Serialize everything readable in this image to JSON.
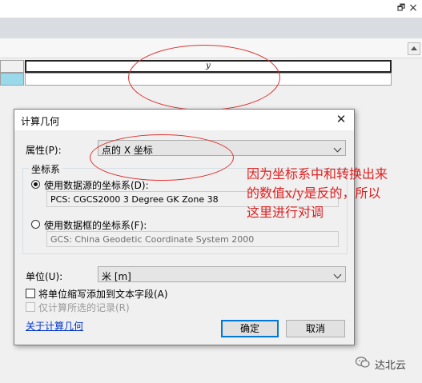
{
  "window": {
    "pin_glyph": "🗗",
    "close_glyph": "×"
  },
  "table": {
    "columns": [
      "y"
    ],
    "rows": [
      [
        ""
      ]
    ]
  },
  "dialog": {
    "title": "计算几何",
    "close_glyph": "✕",
    "property": {
      "label": "属性(P):",
      "value": "点的 X 坐标"
    },
    "crs_group": {
      "title": "坐标系",
      "option_source": {
        "label": "使用数据源的坐标系(D):",
        "value": "PCS: CGCS2000 3 Degree GK Zone 38",
        "selected": true
      },
      "option_frame": {
        "label": "使用数据框的坐标系(F):",
        "value": "GCS: China Geodetic Coordinate System 2000",
        "selected": false
      }
    },
    "unit": {
      "label": "单位(U):",
      "value": "米 [m]"
    },
    "checkbox_abbrev": {
      "label": "将单位缩写添加到文本字段(A)",
      "checked": false
    },
    "checkbox_selected_only": {
      "label": "仅计算所选的记录(R)",
      "checked": false,
      "disabled": true
    },
    "about_link": "关于计算几何",
    "ok_label": "确定",
    "cancel_label": "取消"
  },
  "annotation": {
    "color": "#e02020",
    "lines": [
      "因为坐标系中和转换出来",
      "的数值x/y是反的，所以",
      "这里进行对调"
    ]
  },
  "watermark": {
    "text": "达北云",
    "icon": "wechat-icon"
  }
}
